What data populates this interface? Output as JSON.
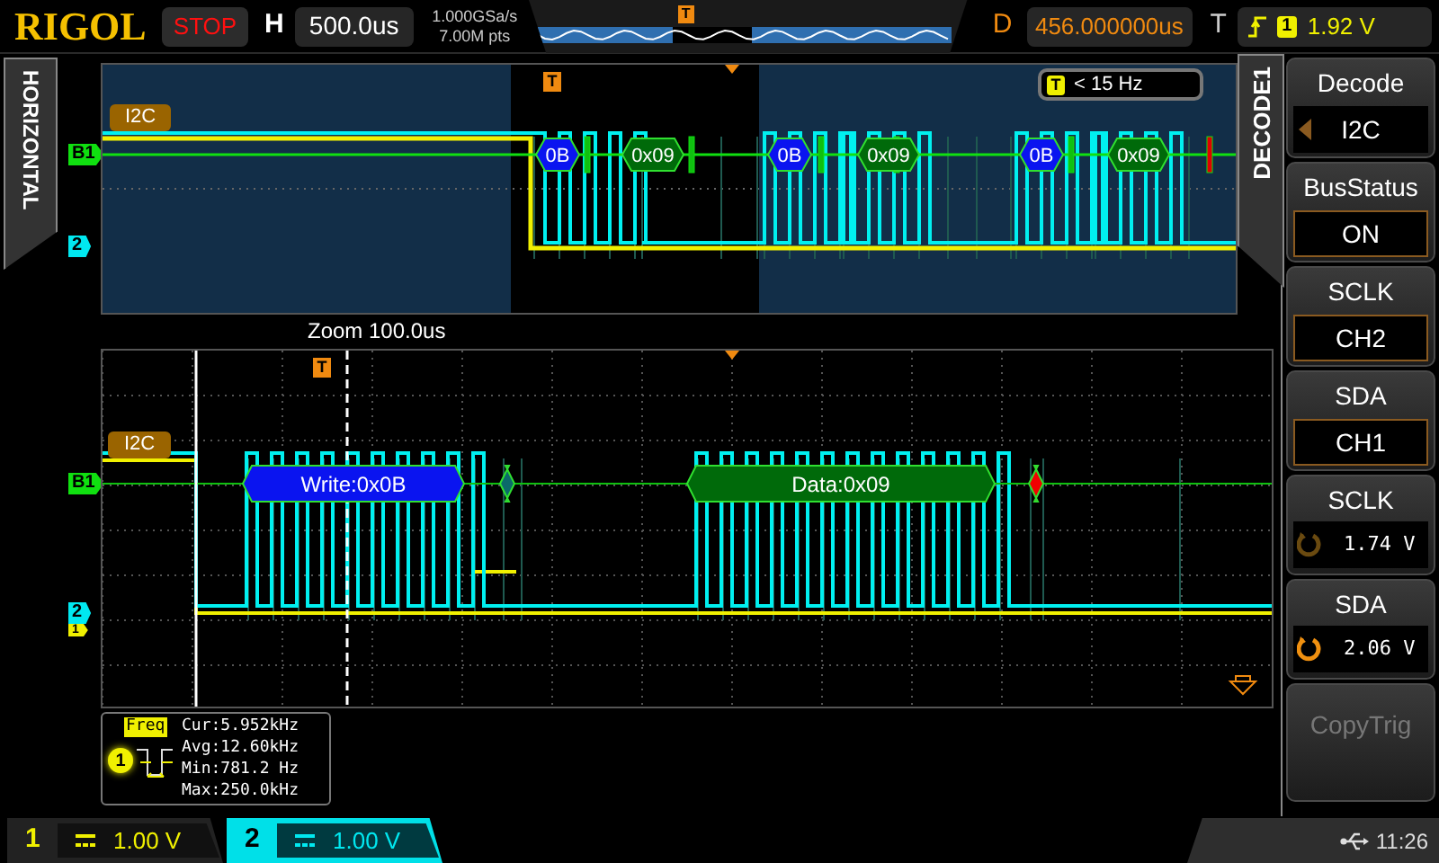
{
  "top_bar": {
    "brand": "RIGOL",
    "run_state": "STOP",
    "h_label": "H",
    "timebase": "500.0us",
    "sample_rate": "1.000GSa/s",
    "memory_depth": "7.00M pts",
    "position_marker": "T",
    "d_label": "D",
    "delay": "456.000000us",
    "t_label": "T",
    "trigger_channel": "1",
    "trigger_level": "1.92 V"
  },
  "side_tab": "HORIZONTAL",
  "main_view": {
    "bus_label": "I2C",
    "bus_marker": "B1",
    "ch2_marker": "2",
    "trigger_marker": "T",
    "freq_badge": "T",
    "trigger_freq": "< 15 Hz",
    "packets": [
      {
        "kind": "address",
        "text": "0B"
      },
      {
        "kind": "data",
        "text": "0x09"
      },
      {
        "kind": "address",
        "text": "0B"
      },
      {
        "kind": "data",
        "text": "0x09"
      },
      {
        "kind": "address",
        "text": "0B"
      },
      {
        "kind": "data",
        "text": "0x09"
      }
    ]
  },
  "zoom_title": "Zoom 100.0us",
  "zoom_view": {
    "bus_label": "I2C",
    "bus_marker": "B1",
    "ch2_marker": "2",
    "ch1_marker": "1",
    "trigger_marker": "T",
    "packets": [
      {
        "kind": "address",
        "text": "Write:0x0B"
      },
      {
        "kind": "ack"
      },
      {
        "kind": "data",
        "text": "Data:0x09"
      },
      {
        "kind": "nack"
      }
    ]
  },
  "measurement": {
    "label": "Freq",
    "channel": "1",
    "lines": [
      "Cur:5.952kHz",
      "Avg:12.60kHz",
      "Min:781.2 Hz",
      "Max:250.0kHz"
    ]
  },
  "menu": {
    "title": "DECODE1",
    "items": [
      {
        "kind": "list",
        "label": "Decode",
        "value": "I2C"
      },
      {
        "kind": "select",
        "label": "BusStatus",
        "value": "ON"
      },
      {
        "kind": "select",
        "label": "SCLK",
        "value": "CH2"
      },
      {
        "kind": "select",
        "label": "SDA",
        "value": "CH1"
      },
      {
        "kind": "knob",
        "label": "SCLK",
        "value": "1.74 V",
        "active": false
      },
      {
        "kind": "knob",
        "label": "SDA",
        "value": "2.06 V",
        "active": true
      },
      {
        "kind": "action",
        "label": "CopyTrig",
        "disabled": true
      }
    ]
  },
  "channels": [
    {
      "number": "1",
      "scale": "1.00 V",
      "color": "#f0f000",
      "selected": false
    },
    {
      "number": "2",
      "scale": "1.00 V",
      "color": "#00e8f0",
      "selected": true
    }
  ],
  "clock": "11:26"
}
